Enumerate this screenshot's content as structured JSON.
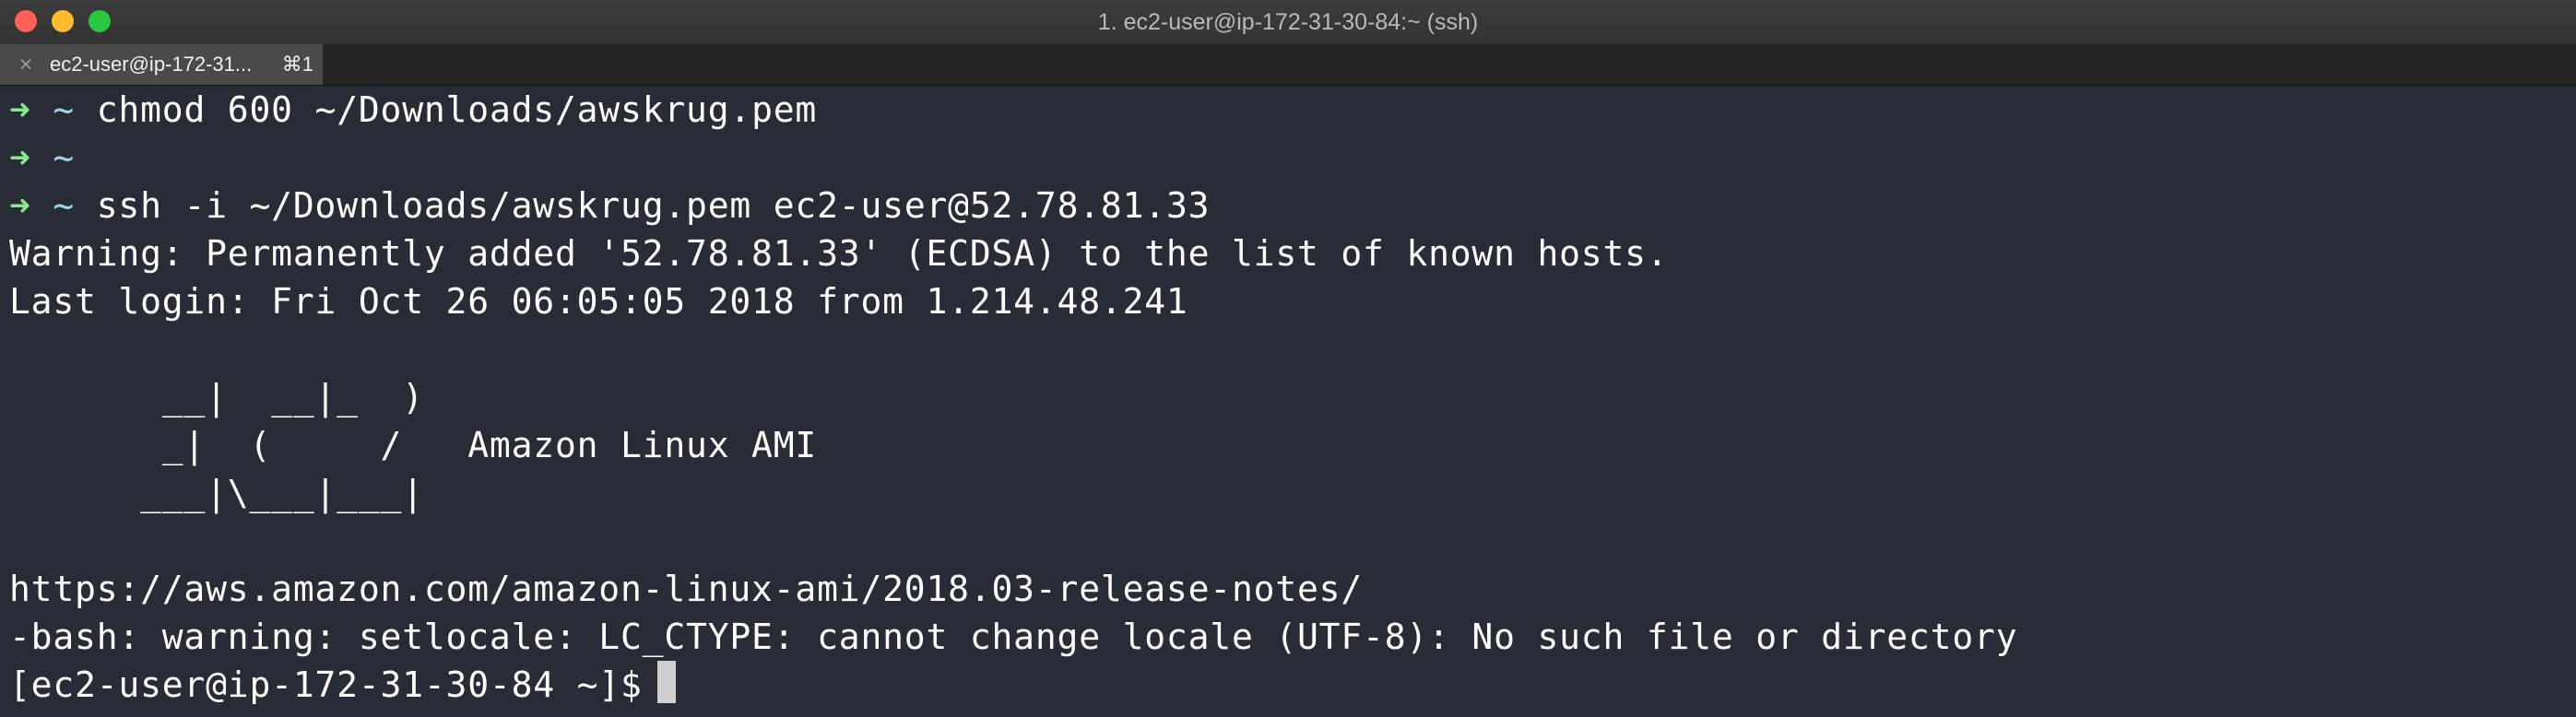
{
  "window": {
    "title": "1. ec2-user@ip-172-31-30-84:~ (ssh)"
  },
  "tab": {
    "title": "ec2-user@ip-172-31...",
    "shortcut": "⌘1",
    "close_icon": "×"
  },
  "terminal": {
    "prompt_symbol": "➜",
    "prompt_dir": "~",
    "commands": [
      " chmod 600 ~/Downloads/awskrug.pem",
      "",
      " ssh -i ~/Downloads/awskrug.pem ec2-user@52.78.81.33"
    ],
    "output_lines": [
      "Warning: Permanently added '52.78.81.33' (ECDSA) to the list of known hosts.",
      "Last login: Fri Oct 26 06:05:05 2018 from 1.214.48.241",
      "       __|  __|_  )",
      "       _|  (     /   Amazon Linux AMI",
      "      ___|\\___|___|",
      "https://aws.amazon.com/amazon-linux-ami/2018.03-release-notes/",
      "-bash: warning: setlocale: LC_CTYPE: cannot change locale (UTF-8): No such file or directory"
    ],
    "remote_prompt": "[ec2-user@ip-172-31-30-84 ~]$"
  },
  "colors": {
    "background": "#282c37",
    "text": "#ffffff",
    "prompt_arrow": "#89e889",
    "prompt_dir": "#9ad7e9",
    "close": "#ff5f57",
    "minimize": "#febc2e",
    "maximize": "#28c840"
  }
}
